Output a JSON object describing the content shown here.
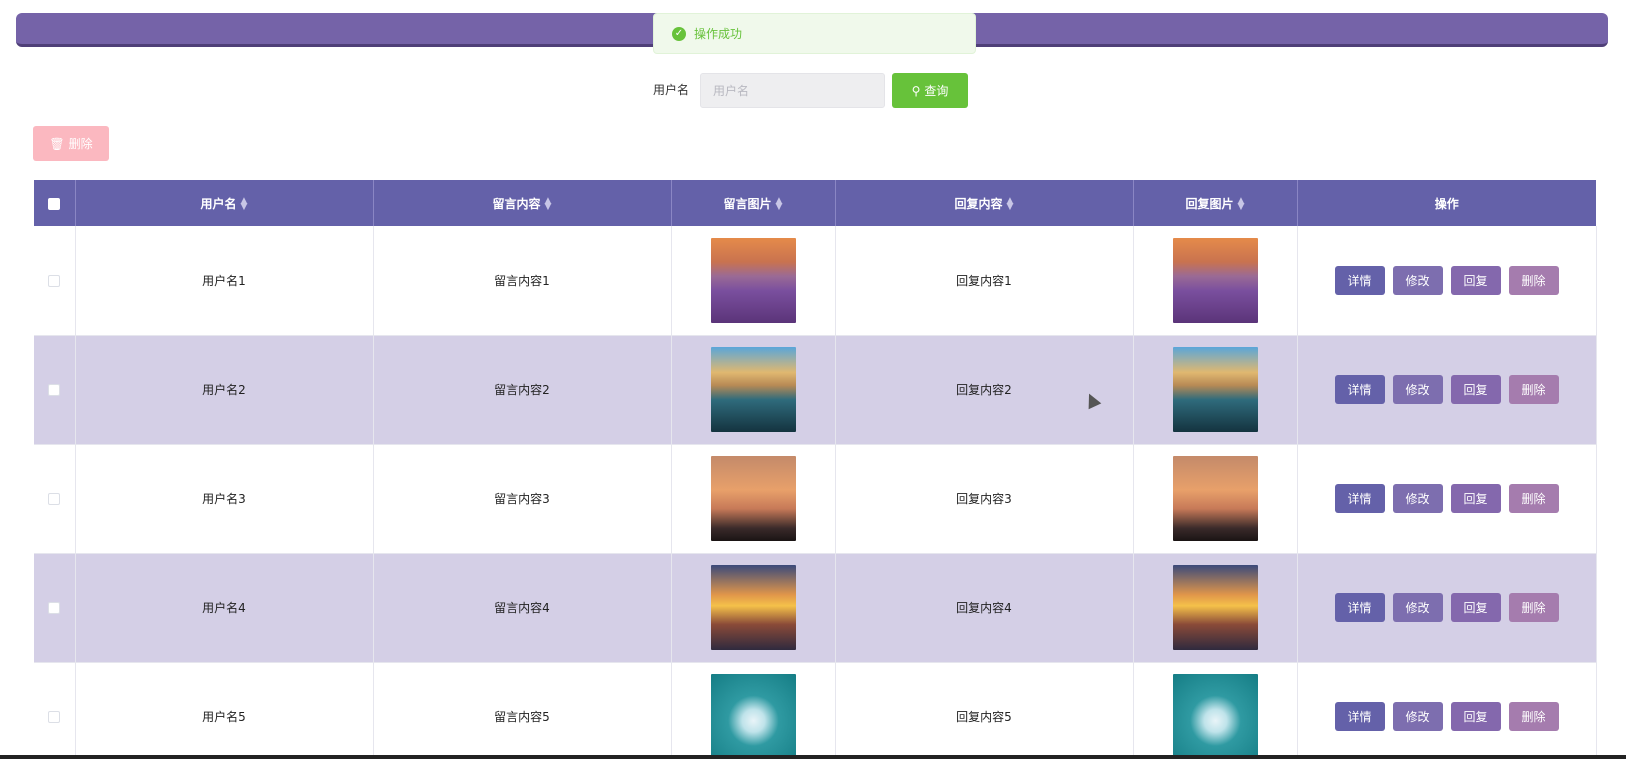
{
  "toast": {
    "message": "操作成功"
  },
  "search": {
    "label": "用户名",
    "placeholder": "用户名",
    "button_label": "查询"
  },
  "toolbar": {
    "delete_label": "删除"
  },
  "table": {
    "headers": [
      "用户名",
      "留言内容",
      "留言图片",
      "回复内容",
      "回复图片",
      "操作"
    ],
    "rows": [
      {
        "username": "用户名1",
        "message": "留言内容1",
        "reply": "回复内容1"
      },
      {
        "username": "用户名2",
        "message": "留言内容2",
        "reply": "回复内容2"
      },
      {
        "username": "用户名3",
        "message": "留言内容3",
        "reply": "回复内容3"
      },
      {
        "username": "用户名4",
        "message": "留言内容4",
        "reply": "回复内容4"
      },
      {
        "username": "用户名5",
        "message": "留言内容5",
        "reply": "回复内容5"
      }
    ],
    "actions": {
      "detail": "详情",
      "edit": "修改",
      "reply": "回复",
      "delete": "删除"
    }
  },
  "colors": {
    "header_purple": "#6461a9",
    "success_green": "#67c23a",
    "row_alt": "#d4cfe6",
    "danger_pink": "#fbb8c0"
  }
}
